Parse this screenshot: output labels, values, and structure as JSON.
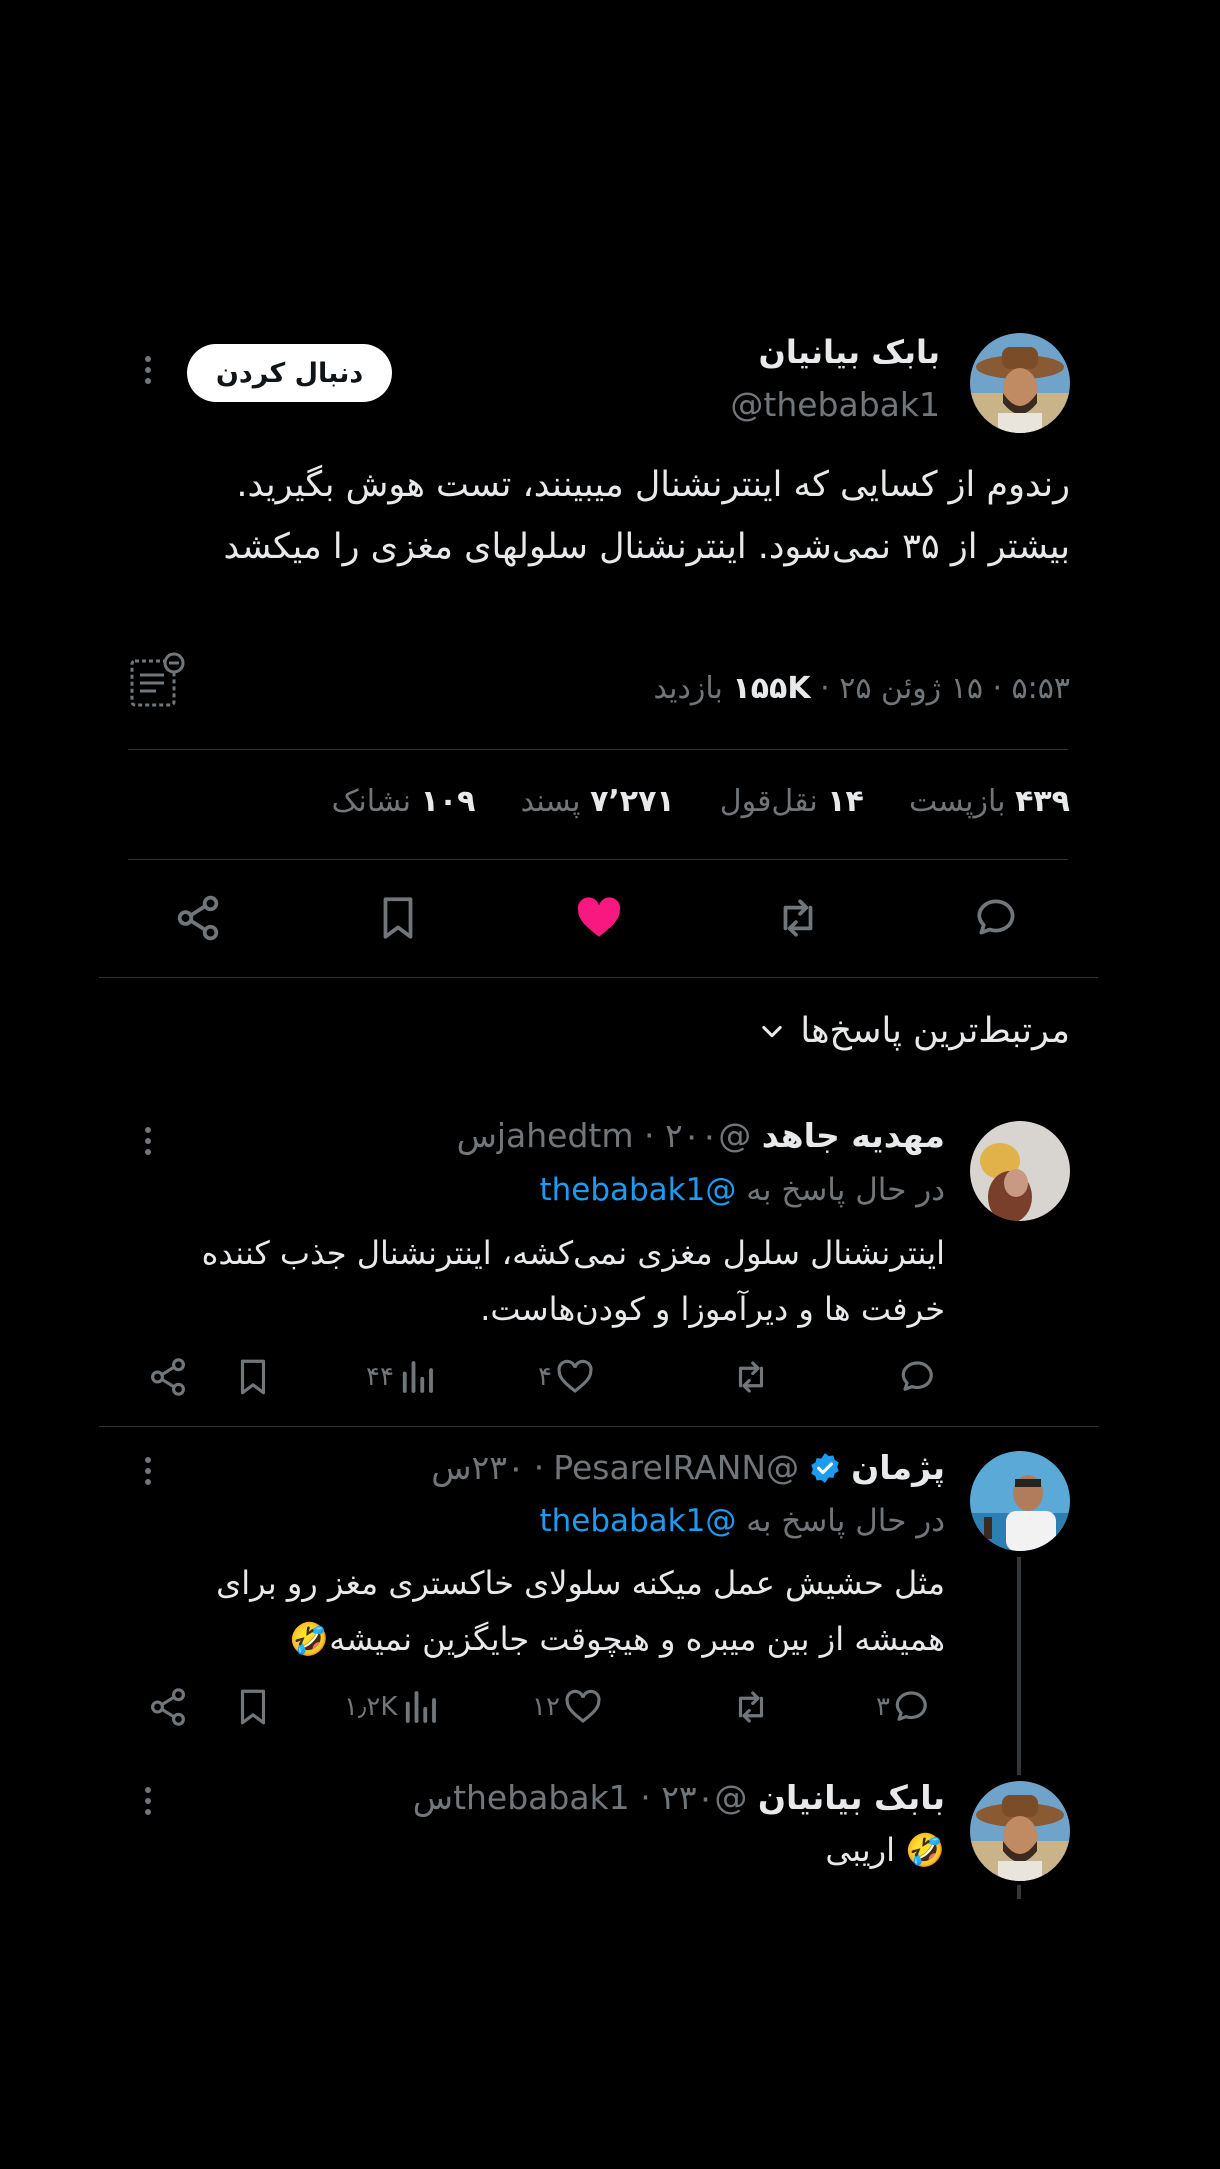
{
  "tweet": {
    "author_name": "بابک بیانیان",
    "author_handle": "@thebabak1",
    "follow_label": "دنبال کردن",
    "text": "رندوم از کسایی که اینترنشنال میبینند، تست هوش بگیرید. بیشتر از ۳۵ نمی‌شود. اینترنشنال سلولهای مغزی را میکشد",
    "meta_time": "۵:۵۳ · ۱۵ ژوئن ۲۵ ·",
    "meta_views_count": "۱۵۵K",
    "meta_views_label": "بازدید",
    "stats": {
      "reposts_count": "۴۳۹",
      "reposts_label": "بازپست",
      "quotes_count": "۱۴",
      "quotes_label": "نقل‌قول",
      "likes_count": "۷٬۲۷۱",
      "likes_label": "پسند",
      "bookmarks_count": "۱۰۹",
      "bookmarks_label": "نشانک"
    },
    "like_color": "#f91880"
  },
  "replies_sort": {
    "label": "مرتبط‌ترین پاسخ‌ها"
  },
  "replies": [
    {
      "name": "مهدیه جاهد",
      "handle": "@jahedtm",
      "time": "۲۰۰س",
      "replying_to_label": "در حال پاسخ به",
      "replying_to": "@thebabak1",
      "text": "اینترنشنال سلول مغزی نمی‌کشه، اینترنشنال جذب کننده خرفت ها و دیرآموزا و کودن‌هاست.",
      "views": "۴۴",
      "likes": "۴",
      "replies_count": "",
      "reposts": ""
    },
    {
      "name": "پژمان",
      "handle": "@PesareIRANN",
      "time": "۲۳۰س",
      "verified": true,
      "replying_to_label": "در حال پاسخ به",
      "replying_to": "@thebabak1",
      "text": "مثل حشیش عمل میکنه سلولای خاکستری مغز رو برای همیشه از بین میبره و هیچوقت جایگزین نمیشه🤣",
      "views": "۱٫۲K",
      "likes": "۱۲",
      "replies_count": "۳",
      "reposts": ""
    },
    {
      "name": "بابک بیانیان",
      "handle": "@thebabak1",
      "time": "۲۳۰س",
      "text": "🤣 اریبی"
    }
  ],
  "icons": [
    "more-icon",
    "list-icon",
    "reply-icon",
    "repost-icon",
    "like-icon",
    "bookmark-icon",
    "share-icon",
    "chevron-down-icon",
    "views-icon",
    "verified-icon"
  ],
  "colors": {
    "background": "#000000",
    "text": "#e7e9ea",
    "muted": "#71767b",
    "link": "#1d9bf0",
    "divider": "#2f3336"
  }
}
